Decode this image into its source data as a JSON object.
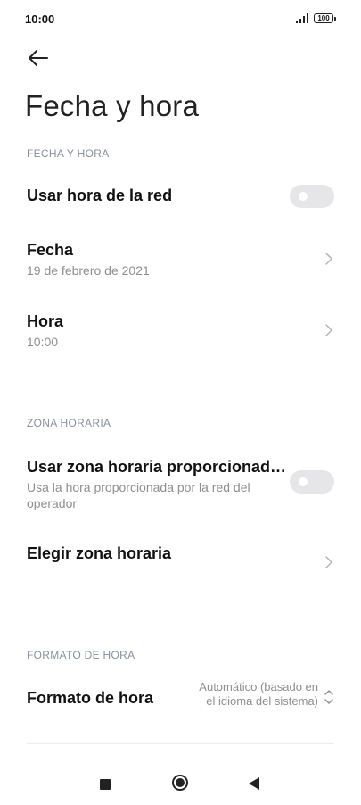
{
  "status_bar": {
    "time": "10:00",
    "battery": "100"
  },
  "page": {
    "title": "Fecha y hora"
  },
  "sections": {
    "date_time": {
      "header": "FECHA Y HORA",
      "network_time": {
        "label": "Usar hora de la red",
        "enabled": false
      },
      "date": {
        "label": "Fecha",
        "value": "19 de febrero de 2021"
      },
      "time": {
        "label": "Hora",
        "value": "10:00"
      }
    },
    "time_zone": {
      "header": "ZONA HORARIA",
      "network_zone": {
        "label": "Usar zona horaria proporcionad…",
        "description": "Usa la hora proporcionada por la red del operador",
        "enabled": false
      },
      "choose_zone": {
        "label": "Elegir zona horaria"
      }
    },
    "time_format": {
      "header": "FORMATO DE HORA",
      "format": {
        "label": "Formato de hora",
        "value": "Automático (basado en el idioma del sistema)"
      }
    }
  },
  "icons": {
    "back": "arrow-left-icon",
    "chevron": "chevron-right-icon",
    "updown": "chevron-up-down-icon"
  }
}
